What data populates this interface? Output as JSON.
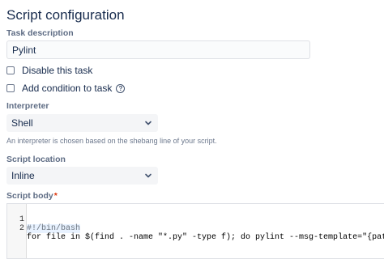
{
  "page": {
    "title": "Script configuration"
  },
  "task_description": {
    "label": "Task description",
    "value": "Pylint"
  },
  "options": {
    "disable_label": "Disable this task",
    "add_condition_label": "Add condition to task",
    "help_glyph": "?"
  },
  "interpreter": {
    "label": "Interpreter",
    "selected": "Shell",
    "helper_text": "An interpreter is chosen based on the shebang line of your script."
  },
  "script_location": {
    "label": "Script location",
    "selected": "Inline"
  },
  "script_body": {
    "label": "Script body",
    "required_mark": "*",
    "lines": [
      {
        "number": "1",
        "text": "#!/bin/bash"
      },
      {
        "number": "2",
        "text": "for file in $(find . -name \"*.py\" -type f); do pylint --msg-template=\"{path}:{l"
      }
    ]
  },
  "icons": {
    "dropdown": "chevron-down-icon",
    "help": "question-circle-icon"
  },
  "colors": {
    "text": "#172b4d",
    "label": "#5e6c84",
    "required": "#de350b",
    "select_bg": "#f4f5f7",
    "input_border": "#dfe1e6"
  }
}
